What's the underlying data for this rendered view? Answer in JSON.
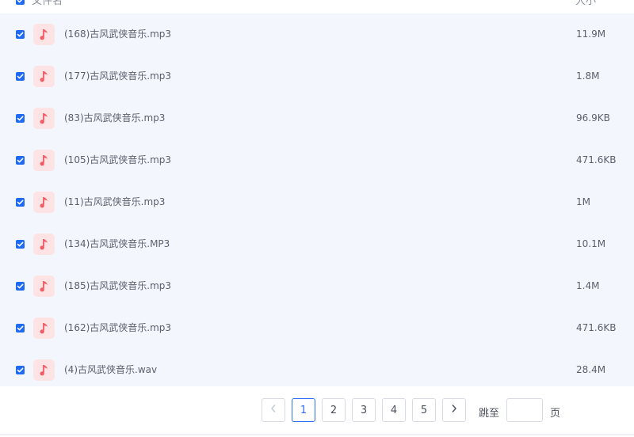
{
  "header": {
    "name_label": "文件名",
    "size_label": "大小"
  },
  "files": [
    {
      "name": "(168)古风武侠音乐.mp3",
      "size": "11.9M",
      "checked": true
    },
    {
      "name": "(177)古风武侠音乐.mp3",
      "size": "1.8M",
      "checked": true
    },
    {
      "name": "(83)古风武侠音乐.mp3",
      "size": "96.9KB",
      "checked": true
    },
    {
      "name": "(105)古风武侠音乐.mp3",
      "size": "471.6KB",
      "checked": true
    },
    {
      "name": "(11)古风武侠音乐.mp3",
      "size": "1M",
      "checked": true
    },
    {
      "name": "(134)古风武侠音乐.MP3",
      "size": "10.1M",
      "checked": true
    },
    {
      "name": "(185)古风武侠音乐.mp3",
      "size": "1.4M",
      "checked": true
    },
    {
      "name": "(162)古风武侠音乐.mp3",
      "size": "471.6KB",
      "checked": true
    },
    {
      "name": "(4)古风武侠音乐.wav",
      "size": "28.4M",
      "checked": true
    }
  ],
  "pagination": {
    "prev_icon": "chevron-left-icon",
    "next_icon": "chevron-right-icon",
    "pages": [
      "1",
      "2",
      "3",
      "4",
      "5"
    ],
    "current_page": "1",
    "jump_label": "跳至",
    "jump_value": "",
    "page_unit": "页"
  },
  "colors": {
    "accent": "#1e6af2",
    "row_background": "#f4f6fe",
    "music_icon": "#f05a64",
    "music_icon_bg": "#fde3e3"
  },
  "icons": {
    "file": "music-note-icon",
    "checkbox": "checkbox-checked-icon"
  }
}
